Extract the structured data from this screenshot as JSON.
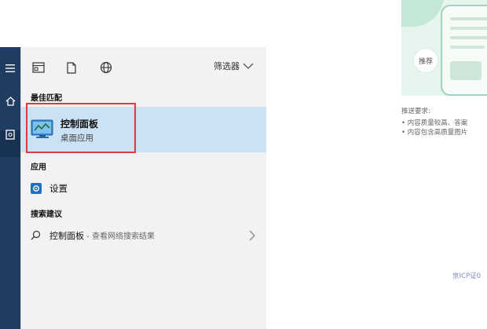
{
  "background_page": {
    "card_badge": "推荐",
    "requirements_title": "推送要求:",
    "requirement_items": [
      "• 内容质量较高、答案",
      "• 内容包含高质量图片"
    ],
    "footer_text": "京ICP证0"
  },
  "toolbar": {
    "filter_label": "筛选器"
  },
  "sections": {
    "best_match": "最佳匹配",
    "apps": "应用",
    "suggestions": "搜索建议"
  },
  "best_match": {
    "title": "控制面板",
    "subtitle": "桌面应用"
  },
  "apps": [
    {
      "label": "设置"
    }
  ],
  "suggestions": [
    {
      "label": "控制面板",
      "hint": " - 查看网络搜索结果"
    }
  ],
  "colors": {
    "panel_bg": "#f2f2f2",
    "selection": "#cbe1f4",
    "highlight_box": "#e0393e",
    "strip": "#1f3c63",
    "accent": "#1e6ec8"
  }
}
